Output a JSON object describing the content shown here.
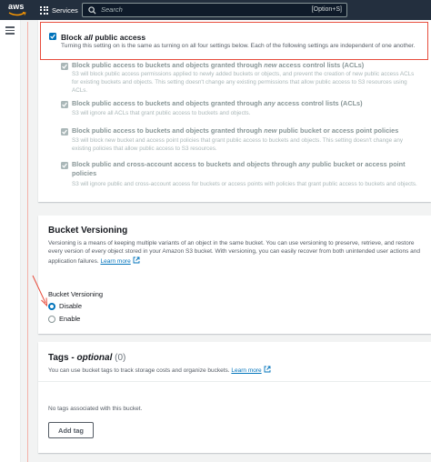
{
  "topbar": {
    "logo_text": "aws",
    "services_label": "Services",
    "search_placeholder": "Search",
    "search_shortcut": "[Option+S]"
  },
  "block_public_access": {
    "main": {
      "title_pre": "Block ",
      "title_emph": "all",
      "title_post": " public access",
      "description": "Turning this setting on is the same as turning on all four settings below. Each of the following settings are independent of one another.",
      "checked": true
    },
    "options": [
      {
        "title_pre": "Block public access to buckets and objects granted through ",
        "title_emph": "new",
        "title_post": " access control lists (ACLs)",
        "description": "S3 will block public access permissions applied to newly added buckets or objects, and prevent the creation of new public access ACLs for existing buckets and objects. This setting doesn't change any existing permissions that allow public access to S3 resources using ACLs.",
        "checked": true
      },
      {
        "title_pre": "Block public access to buckets and objects granted through ",
        "title_emph": "any",
        "title_post": " access control lists (ACLs)",
        "description": "S3 will ignore all ACLs that grant public access to buckets and objects.",
        "checked": true
      },
      {
        "title_pre": "Block public access to buckets and objects granted through ",
        "title_emph": "new",
        "title_post": " public bucket or access point policies",
        "description": "S3 will block new bucket and access point policies that grant public access to buckets and objects. This setting doesn't change any existing policies that allow public access to S3 resources.",
        "checked": true
      },
      {
        "title_pre": "Block public and cross-account access to buckets and objects through ",
        "title_emph": "any",
        "title_post": " public bucket or access point policies",
        "description": "S3 will ignore public and cross-account access for buckets or access points with policies that grant public access to buckets and objects.",
        "checked": true
      }
    ]
  },
  "versioning": {
    "title": "Bucket Versioning",
    "description": "Versioning is a means of keeping multiple variants of an object in the same bucket. You can use versioning to preserve, retrieve, and restore every version of every object stored in your Amazon S3 bucket. With versioning, you can easily recover from both unintended user actions and application failures.",
    "learn_more": "Learn more",
    "field_label": "Bucket Versioning",
    "options": [
      {
        "label": "Disable",
        "selected": true
      },
      {
        "label": "Enable",
        "selected": false
      }
    ]
  },
  "tags": {
    "title": "Tags - ",
    "title_emph": "optional",
    "count": "(0)",
    "description": "You can use bucket tags to track storage costs and organize buckets.",
    "learn_more": "Learn more",
    "empty_text": "No tags associated with this bucket.",
    "add_button": "Add tag"
  },
  "colors": {
    "accent": "#0073bb",
    "topbar": "#232f3e",
    "highlight": "#e74c3c",
    "aws_orange": "#ff9900"
  },
  "icons": {
    "services": "grid-icon",
    "search": "search-icon",
    "menu": "hamburger-icon",
    "external": "external-link-icon"
  }
}
